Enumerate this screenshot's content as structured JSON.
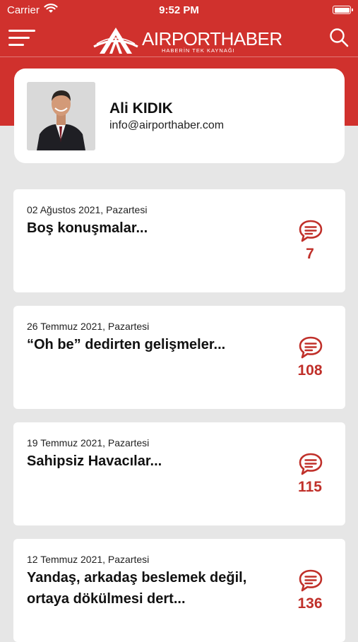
{
  "status_bar": {
    "carrier": "Carrier",
    "time": "9:52 PM"
  },
  "header": {
    "logo_text": "AIRPORTHABER",
    "tagline": "HABERİN TEK KAYNAĞI",
    "menu_icon": "hamburger-menu-icon",
    "search_icon": "search-icon"
  },
  "colors": {
    "brand_red": "#d0312d",
    "count_red": "#c0302a",
    "background": "#e6e6e6"
  },
  "profile": {
    "name": "Ali KIDIK",
    "email": "info@airporthaber.com"
  },
  "articles": [
    {
      "date": "02 Ağustos 2021, Pazartesi",
      "title": "Boş konuşmalar...",
      "comments": "7"
    },
    {
      "date": "26 Temmuz 2021, Pazartesi",
      "title": "“Oh be” dedirten gelişmeler...",
      "comments": "108"
    },
    {
      "date": "19 Temmuz 2021, Pazartesi",
      "title": "Sahipsiz Havacılar...",
      "comments": "115"
    },
    {
      "date": "12 Temmuz 2021, Pazartesi",
      "title": "Yandaş, arkadaş beslemek değil, ortaya dökülmesi dert...",
      "comments": "136"
    }
  ]
}
